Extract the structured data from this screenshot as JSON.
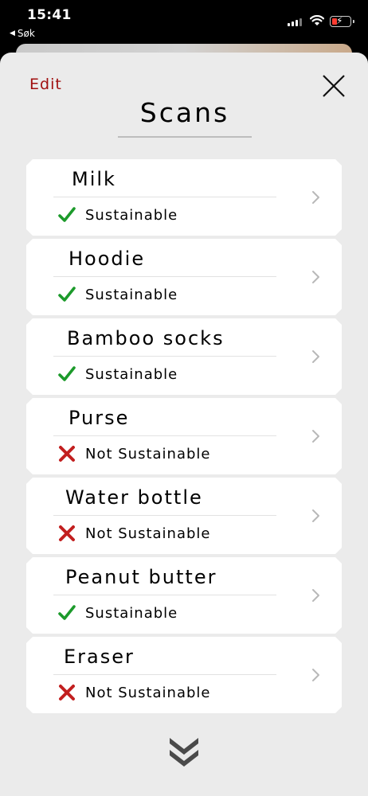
{
  "status_bar": {
    "time": "15:41",
    "back_app": "Søk"
  },
  "header": {
    "edit_label": "Edit",
    "title": "Scans"
  },
  "colors": {
    "accent_red": "#a00f0f",
    "sustainable_green": "#1c9a2b",
    "not_sustainable_red": "#c21f1f"
  },
  "items": [
    {
      "name": "Milk",
      "status": "Sustainable",
      "sustainable": true
    },
    {
      "name": "Hoodie",
      "status": "Sustainable",
      "sustainable": true
    },
    {
      "name": "Bamboo socks",
      "status": "Sustainable",
      "sustainable": true
    },
    {
      "name": "Purse",
      "status": "Not Sustainable",
      "sustainable": false
    },
    {
      "name": "Water bottle",
      "status": "Not Sustainable",
      "sustainable": false
    },
    {
      "name": "Peanut butter",
      "status": "Sustainable",
      "sustainable": true
    },
    {
      "name": "Eraser",
      "status": "Not Sustainable",
      "sustainable": false
    }
  ],
  "icons": {
    "close": "close-icon",
    "chevron": "chevron-right-icon",
    "more": "double-chevron-down-icon",
    "check": "checkmark-icon",
    "cross": "cross-icon"
  }
}
